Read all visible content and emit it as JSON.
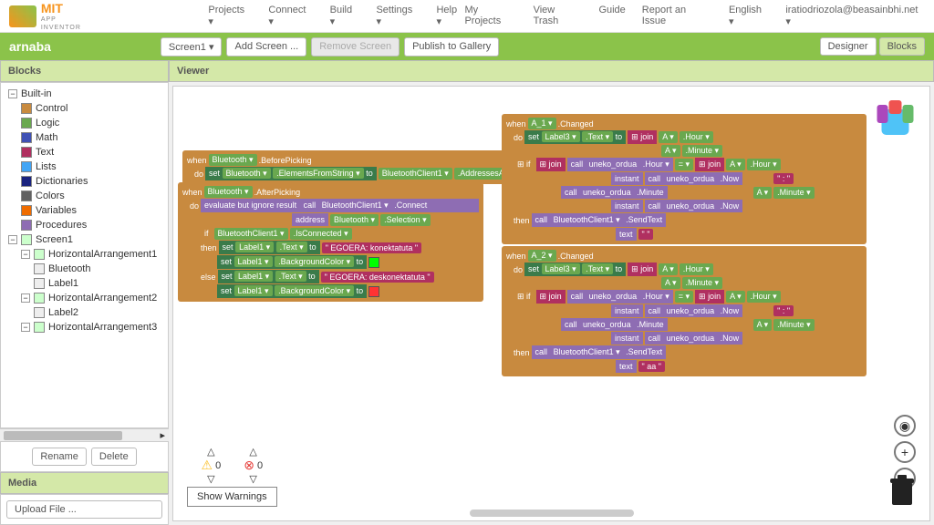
{
  "logo": {
    "brand": "MIT",
    "sub": "APP INVENTOR"
  },
  "topmenu": [
    "Projects ▾",
    "Connect ▾",
    "Build ▾",
    "Settings ▾",
    "Help ▾"
  ],
  "topright": [
    "My Projects",
    "View Trash",
    "Guide",
    "Report an Issue",
    "English ▾",
    "iratiodriozola@beasainbhi.net ▾"
  ],
  "project": "arnaba",
  "screenbtn": "Screen1 ▾",
  "addscreen": "Add Screen ...",
  "removescreen": "Remove Screen",
  "publish": "Publish to Gallery",
  "designer": "Designer",
  "blocks": "Blocks",
  "panel_blocks": "Blocks",
  "panel_viewer": "Viewer",
  "panel_media": "Media",
  "builtin": "Built-in",
  "cats": [
    {
      "label": "Control",
      "color": "#c88a3f"
    },
    {
      "label": "Logic",
      "color": "#6aa84f"
    },
    {
      "label": "Math",
      "color": "#3f51b5"
    },
    {
      "label": "Text",
      "color": "#b03060"
    },
    {
      "label": "Lists",
      "color": "#42a5f5"
    },
    {
      "label": "Dictionaries",
      "color": "#1a237e"
    },
    {
      "label": "Colors",
      "color": "#616161"
    },
    {
      "label": "Variables",
      "color": "#ef6c00"
    },
    {
      "label": "Procedures",
      "color": "#8e6db3"
    }
  ],
  "screens": {
    "root": "Screen1",
    "items": [
      {
        "label": "HorizontalArrangement1",
        "children": [
          "Bluetooth",
          "Label1"
        ]
      },
      {
        "label": "HorizontalArrangement2",
        "children": [
          "Label2"
        ]
      },
      {
        "label": "HorizontalArrangement3",
        "children": []
      }
    ]
  },
  "rename": "Rename",
  "delete": "Delete",
  "upload": "Upload File ...",
  "warn_count": "0",
  "err_count": "0",
  "show_warn": "Show Warnings",
  "blk": {
    "when": "when",
    "do": "do",
    "set": "set",
    "to": "to",
    "call": "call",
    "if": "if",
    "then": "then",
    "else": "else",
    "bluetooth": "Bluetooth ▾",
    "beforepick": ".BeforePicking",
    "afterpick": ".AfterPicking",
    "elements": ".ElementsFromString ▾",
    "btc": "BluetoothClient1 ▾",
    "addr": ".AddressesAndNames ▾",
    "eval": "evaluate but ignore result",
    "connect": ".Connect",
    "address": "address",
    "selection": ".Selection ▾",
    "isconn": ".IsConnected ▾",
    "label1": "Label1 ▾",
    "text": ".Text ▾",
    "bg": ".BackgroundColor ▾",
    "konekt": "\" EGOERA: konektatuta \"",
    "deskon": "\" EGOERA: deskonektatuta \"",
    "a1": "A_1 ▾",
    "a2": "A_2 ▾",
    "changed": ".Changed",
    "label3": "Label3 ▾",
    "join": "join",
    "A": "A ▾",
    "hour": ".Hour ▾",
    "minute": ".Minute ▾",
    "uneko": "uneko_ordua",
    "instant": "instant",
    "now": ".Now",
    "sendtext": ".SendText",
    "textarg": "text",
    "aa": "\" aa \""
  }
}
